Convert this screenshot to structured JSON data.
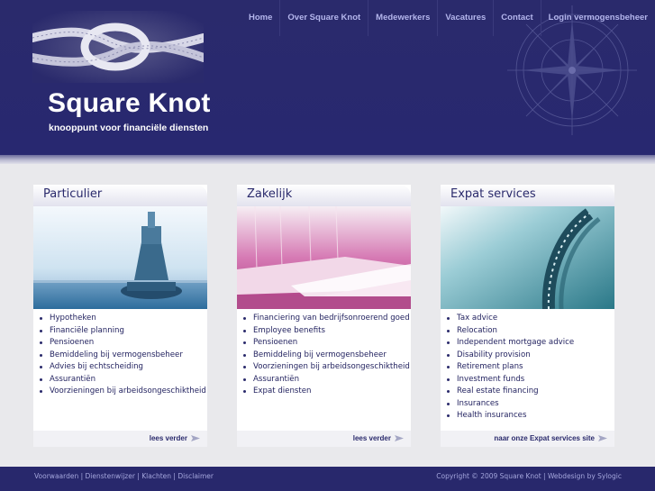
{
  "brand": {
    "title": "Square Knot",
    "tagline": "knooppunt voor financiële diensten"
  },
  "nav": {
    "items": [
      "Home",
      "Over Square Knot",
      "Medewerkers",
      "Vacatures",
      "Contact",
      "Login vermogensbeheer"
    ]
  },
  "columns": [
    {
      "title": "Particulier",
      "image_icon": "buoy-photo",
      "items": [
        "Hypotheken",
        "Financiële planning",
        "Pensioenen",
        "Bemiddeling bij vermogensbeheer",
        "Advies bij echtscheiding",
        "Assurantiën",
        "Voorzieningen bij arbeidsongeschiktheid"
      ],
      "link": "lees verder"
    },
    {
      "title": "Zakelijk",
      "image_icon": "yachts-photo",
      "items": [
        "Financiering van bedrijfsonroerend goed",
        "Employee benefits",
        "Pensioenen",
        "Bemiddeling bij vermogensbeheer",
        "Voorzieningen bij arbeidsongeschiktheid",
        "Assurantiën",
        "Expat diensten"
      ],
      "link": "lees verder"
    },
    {
      "title": "Expat services",
      "image_icon": "chain-photo",
      "items": [
        "Tax advice",
        "Relocation",
        "Independent mortgage advice",
        "Disability provision",
        "Retirement plans",
        "Investment funds",
        "Real estate financing",
        "Insurances",
        "Health insurances"
      ],
      "link": "naar onze Expat services site"
    }
  ],
  "footer": {
    "links": [
      "Voorwaarden",
      "Dienstenwijzer",
      "Klachten",
      "Disclaimer"
    ],
    "copyright": "Copyright © 2009 Square Knot | Webdesign by Sylogic"
  },
  "colors": {
    "brand_navy": "#2a2a6c",
    "nav_text": "#b4b6ec",
    "page_bg": "#e9e9ec"
  }
}
